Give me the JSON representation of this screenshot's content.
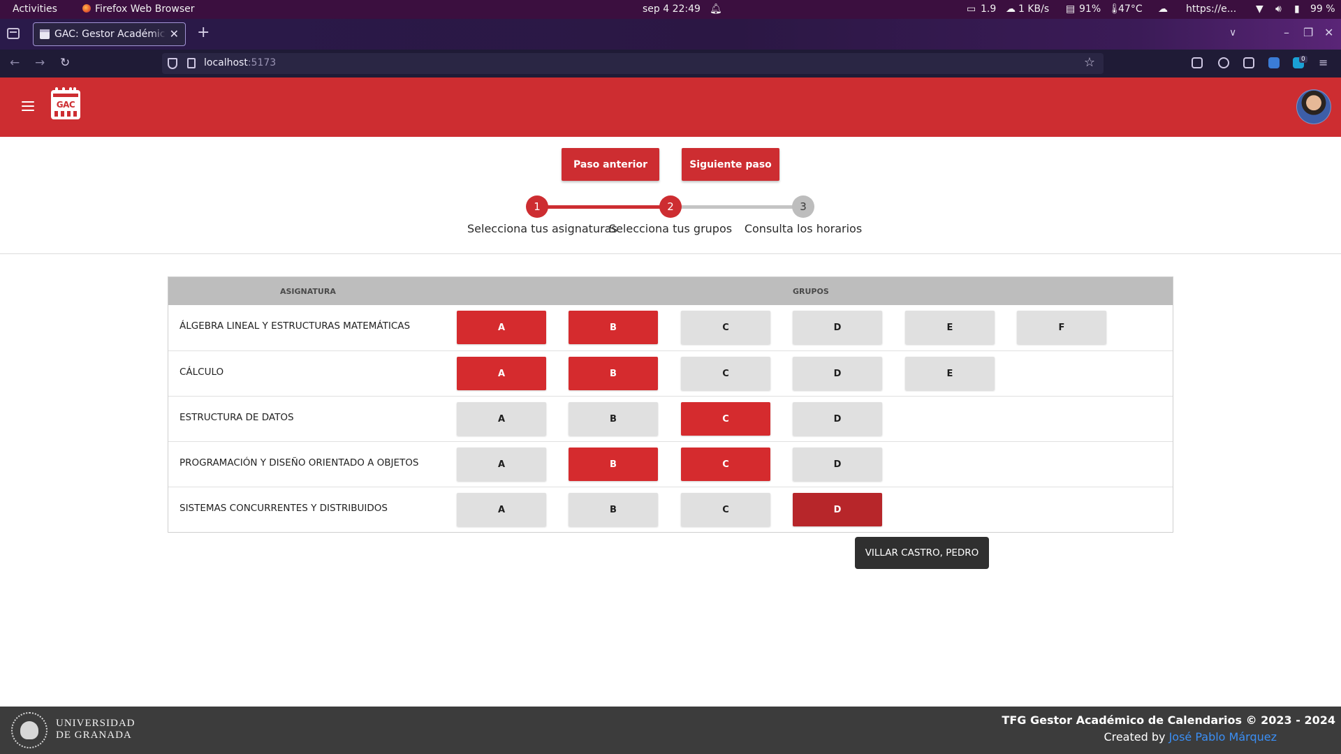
{
  "system_bar": {
    "activities": "Activities",
    "app_name": "Firefox Web Browser",
    "datetime": "sep 4  22:49",
    "load": "1.9",
    "net": "1 KB/s",
    "mem": "91%",
    "temp": "47°C",
    "url_indicator": "https://e...",
    "battery": "99 %"
  },
  "browser": {
    "tab_title": "GAC: Gestor Académico de Calendarios",
    "url_host": "localhost",
    "url_port": ":5173",
    "extension_badge": "0"
  },
  "app": {
    "logo_text": "GAC"
  },
  "stepper": {
    "prev_label": "Paso anterior",
    "next_label": "Siguiente paso",
    "steps": [
      {
        "number": "1",
        "label": "Selecciona tus asignaturas"
      },
      {
        "number": "2",
        "label": "Selecciona tus grupos"
      },
      {
        "number": "3",
        "label": "Consulta los horarios"
      }
    ],
    "current_step": 2
  },
  "table": {
    "headers": {
      "subject": "ASIGNATURA",
      "groups": "GRUPOS"
    },
    "rows": [
      {
        "subject": "ÁLGEBRA LINEAL Y ESTRUCTURAS MATEMÁTICAS",
        "groups": [
          {
            "label": "A",
            "selected": true
          },
          {
            "label": "B",
            "selected": true
          },
          {
            "label": "C",
            "selected": false
          },
          {
            "label": "D",
            "selected": false
          },
          {
            "label": "E",
            "selected": false
          },
          {
            "label": "F",
            "selected": false
          }
        ]
      },
      {
        "subject": "CÁLCULO",
        "groups": [
          {
            "label": "A",
            "selected": true
          },
          {
            "label": "B",
            "selected": true
          },
          {
            "label": "C",
            "selected": false
          },
          {
            "label": "D",
            "selected": false
          },
          {
            "label": "E",
            "selected": false
          }
        ]
      },
      {
        "subject": "ESTRUCTURA DE DATOS",
        "groups": [
          {
            "label": "A",
            "selected": false
          },
          {
            "label": "B",
            "selected": false
          },
          {
            "label": "C",
            "selected": true
          },
          {
            "label": "D",
            "selected": false
          }
        ]
      },
      {
        "subject": "PROGRAMACIÓN Y DISEÑO ORIENTADO A OBJETOS",
        "groups": [
          {
            "label": "A",
            "selected": false
          },
          {
            "label": "B",
            "selected": true
          },
          {
            "label": "C",
            "selected": true
          },
          {
            "label": "D",
            "selected": false
          }
        ]
      },
      {
        "subject": "SISTEMAS CONCURRENTES Y DISTRIBUIDOS",
        "groups": [
          {
            "label": "A",
            "selected": false
          },
          {
            "label": "B",
            "selected": false
          },
          {
            "label": "C",
            "selected": false
          },
          {
            "label": "D",
            "selected": true,
            "hovered": true
          }
        ]
      }
    ]
  },
  "tooltip": "VILLAR CASTRO, PEDRO",
  "footer": {
    "university_line1": "UNIVERSIDAD",
    "university_line2": "DE GRANADA",
    "title": "TFG Gestor Académico de Calendarios © 2023 - 2024",
    "created_by": "Created by ",
    "author": "José Pablo Márquez"
  },
  "colors": {
    "brand_red": "#cd2d31",
    "group_selected": "#d52b2e",
    "group_unselected": "#e0e0e0",
    "link_blue": "#3b8ff5"
  }
}
